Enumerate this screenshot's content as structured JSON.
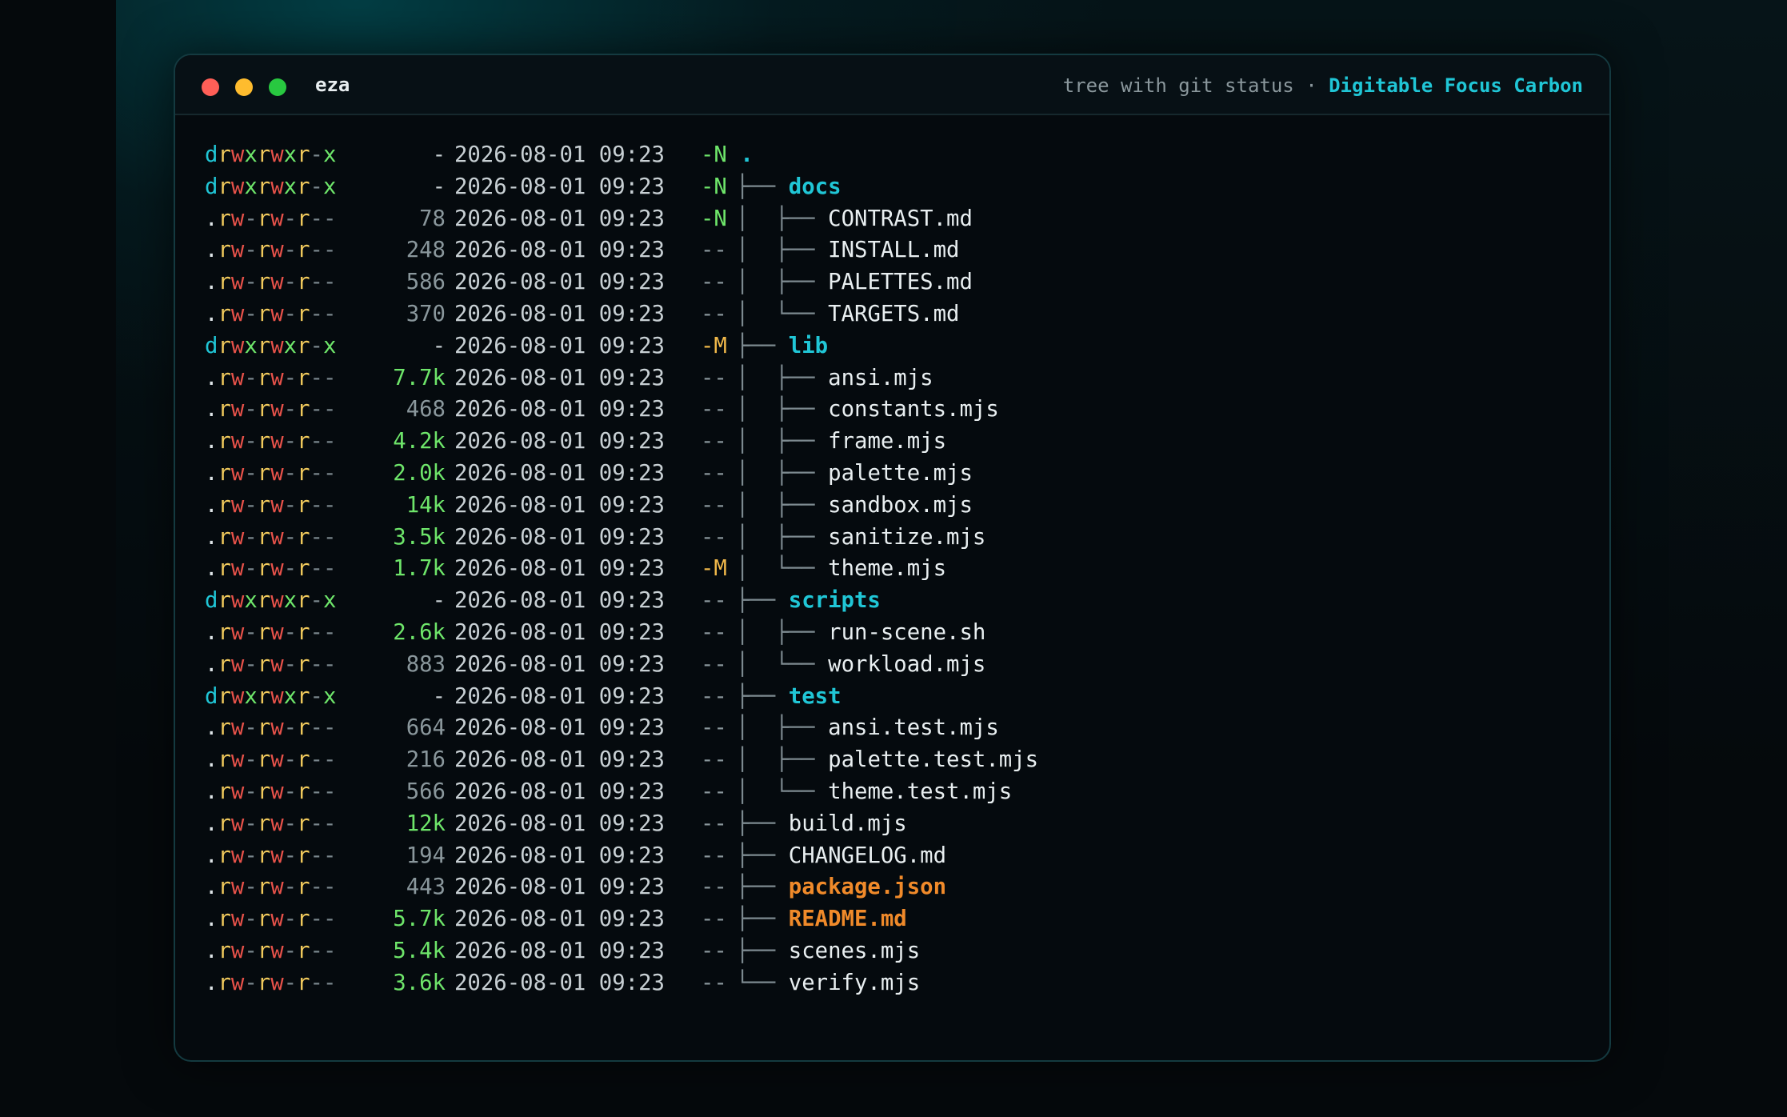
{
  "window": {
    "app_title": "eza",
    "subtitle": "tree with git status",
    "separator": "·",
    "theme_name": "Digitable Focus Carbon"
  },
  "colors": {
    "accent": "#20c6d6",
    "red_light": "#ff5f57",
    "yellow_light": "#febc2e",
    "green_light": "#28c840",
    "orange_file": "#f08a2a"
  },
  "rows": [
    {
      "perm": "drwxrwxr-x",
      "size": "-",
      "date": "2026-08-01 09:23",
      "git": "-N",
      "branch": "",
      "name": ".",
      "kind": "root"
    },
    {
      "perm": "drwxrwxr-x",
      "size": "-",
      "date": "2026-08-01 09:23",
      "git": "-N",
      "branch": "├──",
      "name": "docs",
      "kind": "dir"
    },
    {
      "perm": ".rw-rw-r--",
      "size": "78",
      "date": "2026-08-01 09:23",
      "git": "-N",
      "branch": "│  ├──",
      "name": "CONTRAST.md",
      "kind": "file"
    },
    {
      "perm": ".rw-rw-r--",
      "size": "248",
      "date": "2026-08-01 09:23",
      "git": "--",
      "branch": "│  ├──",
      "name": "INSTALL.md",
      "kind": "file"
    },
    {
      "perm": ".rw-rw-r--",
      "size": "586",
      "date": "2026-08-01 09:23",
      "git": "--",
      "branch": "│  ├──",
      "name": "PALETTES.md",
      "kind": "file"
    },
    {
      "perm": ".rw-rw-r--",
      "size": "370",
      "date": "2026-08-01 09:23",
      "git": "--",
      "branch": "│  └──",
      "name": "TARGETS.md",
      "kind": "file"
    },
    {
      "perm": "drwxrwxr-x",
      "size": "-",
      "date": "2026-08-01 09:23",
      "git": "-M",
      "branch": "├──",
      "name": "lib",
      "kind": "dir"
    },
    {
      "perm": ".rw-rw-r--",
      "size": "7.7k",
      "date": "2026-08-01 09:23",
      "git": "--",
      "branch": "│  ├──",
      "name": "ansi.mjs",
      "kind": "file"
    },
    {
      "perm": ".rw-rw-r--",
      "size": "468",
      "date": "2026-08-01 09:23",
      "git": "--",
      "branch": "│  ├──",
      "name": "constants.mjs",
      "kind": "file"
    },
    {
      "perm": ".rw-rw-r--",
      "size": "4.2k",
      "date": "2026-08-01 09:23",
      "git": "--",
      "branch": "│  ├──",
      "name": "frame.mjs",
      "kind": "file"
    },
    {
      "perm": ".rw-rw-r--",
      "size": "2.0k",
      "date": "2026-08-01 09:23",
      "git": "--",
      "branch": "│  ├──",
      "name": "palette.mjs",
      "kind": "file"
    },
    {
      "perm": ".rw-rw-r--",
      "size": "14k",
      "date": "2026-08-01 09:23",
      "git": "--",
      "branch": "│  ├──",
      "name": "sandbox.mjs",
      "kind": "file"
    },
    {
      "perm": ".rw-rw-r--",
      "size": "3.5k",
      "date": "2026-08-01 09:23",
      "git": "--",
      "branch": "│  ├──",
      "name": "sanitize.mjs",
      "kind": "file"
    },
    {
      "perm": ".rw-rw-r--",
      "size": "1.7k",
      "date": "2026-08-01 09:23",
      "git": "-M",
      "branch": "│  └──",
      "name": "theme.mjs",
      "kind": "file"
    },
    {
      "perm": "drwxrwxr-x",
      "size": "-",
      "date": "2026-08-01 09:23",
      "git": "--",
      "branch": "├──",
      "name": "scripts",
      "kind": "dir"
    },
    {
      "perm": ".rw-rw-r--",
      "size": "2.6k",
      "date": "2026-08-01 09:23",
      "git": "--",
      "branch": "│  ├──",
      "name": "run-scene.sh",
      "kind": "file"
    },
    {
      "perm": ".rw-rw-r--",
      "size": "883",
      "date": "2026-08-01 09:23",
      "git": "--",
      "branch": "│  └──",
      "name": "workload.mjs",
      "kind": "file"
    },
    {
      "perm": "drwxrwxr-x",
      "size": "-",
      "date": "2026-08-01 09:23",
      "git": "--",
      "branch": "├──",
      "name": "test",
      "kind": "dir"
    },
    {
      "perm": ".rw-rw-r--",
      "size": "664",
      "date": "2026-08-01 09:23",
      "git": "--",
      "branch": "│  ├──",
      "name": "ansi.test.mjs",
      "kind": "file"
    },
    {
      "perm": ".rw-rw-r--",
      "size": "216",
      "date": "2026-08-01 09:23",
      "git": "--",
      "branch": "│  ├──",
      "name": "palette.test.mjs",
      "kind": "file"
    },
    {
      "perm": ".rw-rw-r--",
      "size": "566",
      "date": "2026-08-01 09:23",
      "git": "--",
      "branch": "│  └──",
      "name": "theme.test.mjs",
      "kind": "file"
    },
    {
      "perm": ".rw-rw-r--",
      "size": "12k",
      "date": "2026-08-01 09:23",
      "git": "--",
      "branch": "├──",
      "name": "build.mjs",
      "kind": "file"
    },
    {
      "perm": ".rw-rw-r--",
      "size": "194",
      "date": "2026-08-01 09:23",
      "git": "--",
      "branch": "├──",
      "name": "CHANGELOG.md",
      "kind": "file"
    },
    {
      "perm": ".rw-rw-r--",
      "size": "443",
      "date": "2026-08-01 09:23",
      "git": "--",
      "branch": "├──",
      "name": "package.json",
      "kind": "highlight"
    },
    {
      "perm": ".rw-rw-r--",
      "size": "5.7k",
      "date": "2026-08-01 09:23",
      "git": "--",
      "branch": "├──",
      "name": "README.md",
      "kind": "highlight"
    },
    {
      "perm": ".rw-rw-r--",
      "size": "5.4k",
      "date": "2026-08-01 09:23",
      "git": "--",
      "branch": "├──",
      "name": "scenes.mjs",
      "kind": "file"
    },
    {
      "perm": ".rw-rw-r--",
      "size": "3.6k",
      "date": "2026-08-01 09:23",
      "git": "--",
      "branch": "└──",
      "name": "verify.mjs",
      "kind": "file"
    }
  ]
}
